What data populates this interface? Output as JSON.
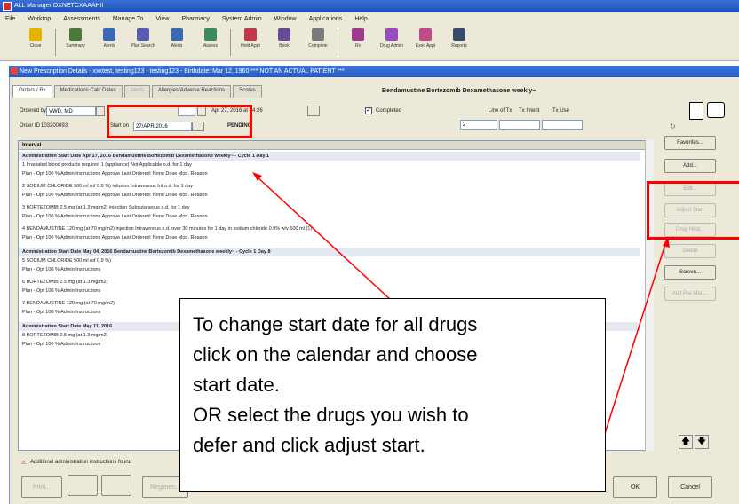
{
  "app": {
    "title": "ALL Manager OXNETCXAAAHII"
  },
  "menu": [
    "File",
    "Worktop",
    "Assessments",
    "Manage To",
    "View",
    "Pharmacy",
    "System Admin",
    "Window",
    "Applications",
    "Help"
  ],
  "toolbar": [
    {
      "label": "Close",
      "color": "#e6b300"
    },
    {
      "label": "Summary",
      "color": "#4a7a3a"
    },
    {
      "label": "Alerts",
      "color": "#3a6ab5"
    },
    {
      "label": "Plan Search",
      "color": "#5a5ab5"
    },
    {
      "label": "Alerts",
      "color": "#3a6ab5"
    },
    {
      "label": "Assess",
      "color": "#3a8a5a"
    },
    {
      "label": "Hold Appt",
      "color": "#c0394a"
    },
    {
      "label": "Book",
      "color": "#6a4a9a"
    },
    {
      "label": "Complete",
      "color": "#7a7a7a"
    },
    {
      "label": "Rx",
      "color": "#a03a8a"
    },
    {
      "label": "Drug Admin",
      "color": "#9a4ac0"
    },
    {
      "label": "Exec Appt",
      "color": "#c04a8a"
    },
    {
      "label": "Reports",
      "color": "#3a4a6a"
    }
  ],
  "window": {
    "title": "New Prescription Details - xxxtest, testing123 - testing123 - Birthdate: Mar 12, 1960 *** NOT AN ACTUAL PATIENT ***"
  },
  "tabs": [
    "Orders / Rx",
    "Medications Calc Dates",
    "Alerts",
    "Allergies/Adverse Reactions",
    "Scores"
  ],
  "regimen_title": "Bendamustine Bortezomib Dexamethasone weekly~",
  "form": {
    "ordered_by_label": "Ordered by",
    "ordered_by_value": "VWD, MD",
    "order_id_label": "Order ID",
    "order_id_value": "103200093",
    "start_on_label": "Start on",
    "start_on_value": "27/APR/2016",
    "date_label": "Apr 27, 2016 at 14:26",
    "status": "PENDING",
    "completed_label": "Completed",
    "line_of_tx": "Line of Tx",
    "tx_intent": "Tx Intent",
    "tx_use": "Tx Use",
    "line_value": "2"
  },
  "grid": {
    "header": "Interval",
    "rows": [
      {
        "kind": "section",
        "text": "Administration Start Date Apr 27, 2016            Bendamustine Bortezomib Dexamethasone weekly~ - Cycle 1 Day 1"
      },
      {
        "kind": "drug",
        "text": "1  Irradiated blood products required  1 (appliance) Not Applicable o.d. for 1 day"
      },
      {
        "kind": "sub",
        "text": "Plan - Opt   100 %   Admin Instructions   Approve        Last Ordered: None                    Dose Mod. Reason"
      },
      {
        "kind": "drug",
        "text": "2  SODIUM CHLORIDE  500 ml (of 0.9 %) infusion Intravenous Inf o.d. for 1 day"
      },
      {
        "kind": "sub",
        "text": "Plan - Opt   100 %   Admin Instructions   Approve        Last Ordered: None                    Dose Mod. Reason"
      },
      {
        "kind": "drug",
        "text": "3  BORTEZOMIB  2.5 mg (at 1.3 mg/m2) injection Subcutaneous o.d. for 1 day"
      },
      {
        "kind": "sub",
        "text": "Plan - Opt   100 %   Admin Instructions   Approve        Last Ordered: None                    Dose Mod. Reason"
      },
      {
        "kind": "drug",
        "text": "4  BENDAMUSTINE  120 mg (at 70 mg/m2) injection Intravenous o.d. over 30 minutes for 1 day in sodium chloride 0.9% w/v 500 ml (1)"
      },
      {
        "kind": "sub",
        "text": "Plan - Opt   100 %   Admin Instructions   Approve        Last Ordered: None                    Dose Mod. Reason"
      },
      {
        "kind": "section",
        "text": "Administration Start Date May 04, 2016            Bendamustine Bortezomib Dexamethasone weekly~ - Cycle 1 Day 8"
      },
      {
        "kind": "drug",
        "text": "5  SODIUM CHLORIDE  500 ml (of 0.9 %)"
      },
      {
        "kind": "sub",
        "text": "Plan - Opt   100 %   Admin Instructions"
      },
      {
        "kind": "drug",
        "text": "6  BORTEZOMIB  2.5 mg (at 1.3 mg/m2)"
      },
      {
        "kind": "sub",
        "text": "Plan - Opt   100 %   Admin Instructions"
      },
      {
        "kind": "drug",
        "text": "7  BENDAMUSTINE  120 mg (at 70 mg/m2)"
      },
      {
        "kind": "sub",
        "text": "Plan - Opt   100 %   Admin Instructions"
      },
      {
        "kind": "section",
        "text": "Administration Start Date May 11, 2016"
      },
      {
        "kind": "drug",
        "text": "8  BORTEZOMIB  2.5 mg (at 1.3 mg/m2)"
      },
      {
        "kind": "sub",
        "text": "Plan - Opt   100 %   Admin Instructions"
      }
    ]
  },
  "side_buttons": [
    {
      "label": "Favorites...",
      "enabled": true
    },
    {
      "label": "Add...",
      "enabled": true
    },
    {
      "label": "Edit...",
      "enabled": false
    },
    {
      "label": "Adjust Start",
      "enabled": false
    },
    {
      "label": "Drug Hold...",
      "enabled": false
    },
    {
      "label": "Delete",
      "enabled": false
    },
    {
      "label": "Screen...",
      "enabled": true
    },
    {
      "label": "Add Pre-Med...",
      "enabled": false
    }
  ],
  "instructions_note": "Additional administration instructions found",
  "bottom_buttons": {
    "print": "Print...",
    "regimen": "Regimen...",
    "ok": "OK",
    "cancel": "Cancel"
  },
  "callout": {
    "lines": [
      "To change start date for all drugs",
      "click on the calendar and choose",
      "start date.",
      "OR select the drugs you wish to",
      "defer and click adjust start."
    ]
  },
  "colors": {
    "highlight": "#ff0000",
    "titlebar": "#2559c4"
  }
}
